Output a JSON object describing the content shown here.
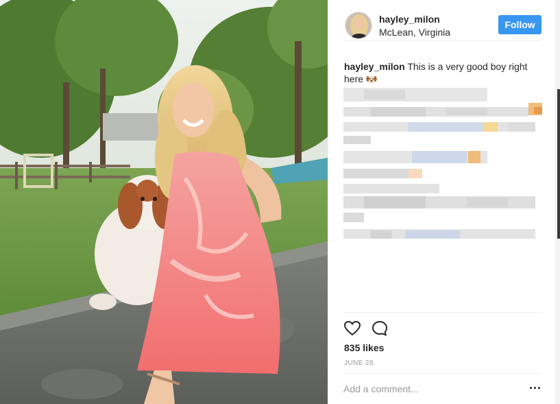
{
  "post": {
    "username": "hayley_milon",
    "location": "McLean, Virginia",
    "follow_label": "Follow"
  },
  "caption": {
    "username": "hayley_milon",
    "text": "This is a very good boy right here",
    "emoji": "puppy-face-emoji"
  },
  "actions": {
    "like_icon": "heart-icon",
    "comment_icon": "comment-bubble-icon"
  },
  "likes": "835 likes",
  "date": "JUNE 28",
  "comment": {
    "placeholder": "Add a comment...",
    "more_icon": "more-options-icon"
  },
  "colors": {
    "follow_button": "#3897f0",
    "text": "#262626",
    "muted": "#999999",
    "divider": "#efefef"
  }
}
